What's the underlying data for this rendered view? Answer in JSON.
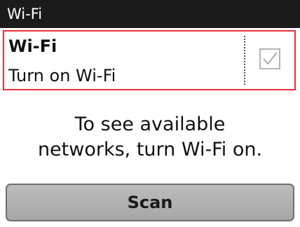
{
  "title_bar": {
    "title": "Wi-Fi"
  },
  "wifi_toggle": {
    "label": "Wi-Fi",
    "summary": "Turn on Wi-Fi",
    "checked": true,
    "highlight_color": "#e8303a"
  },
  "message": {
    "line1": "To see available",
    "line2": "networks, turn Wi-Fi on."
  },
  "scan_button": {
    "label": "Scan"
  }
}
